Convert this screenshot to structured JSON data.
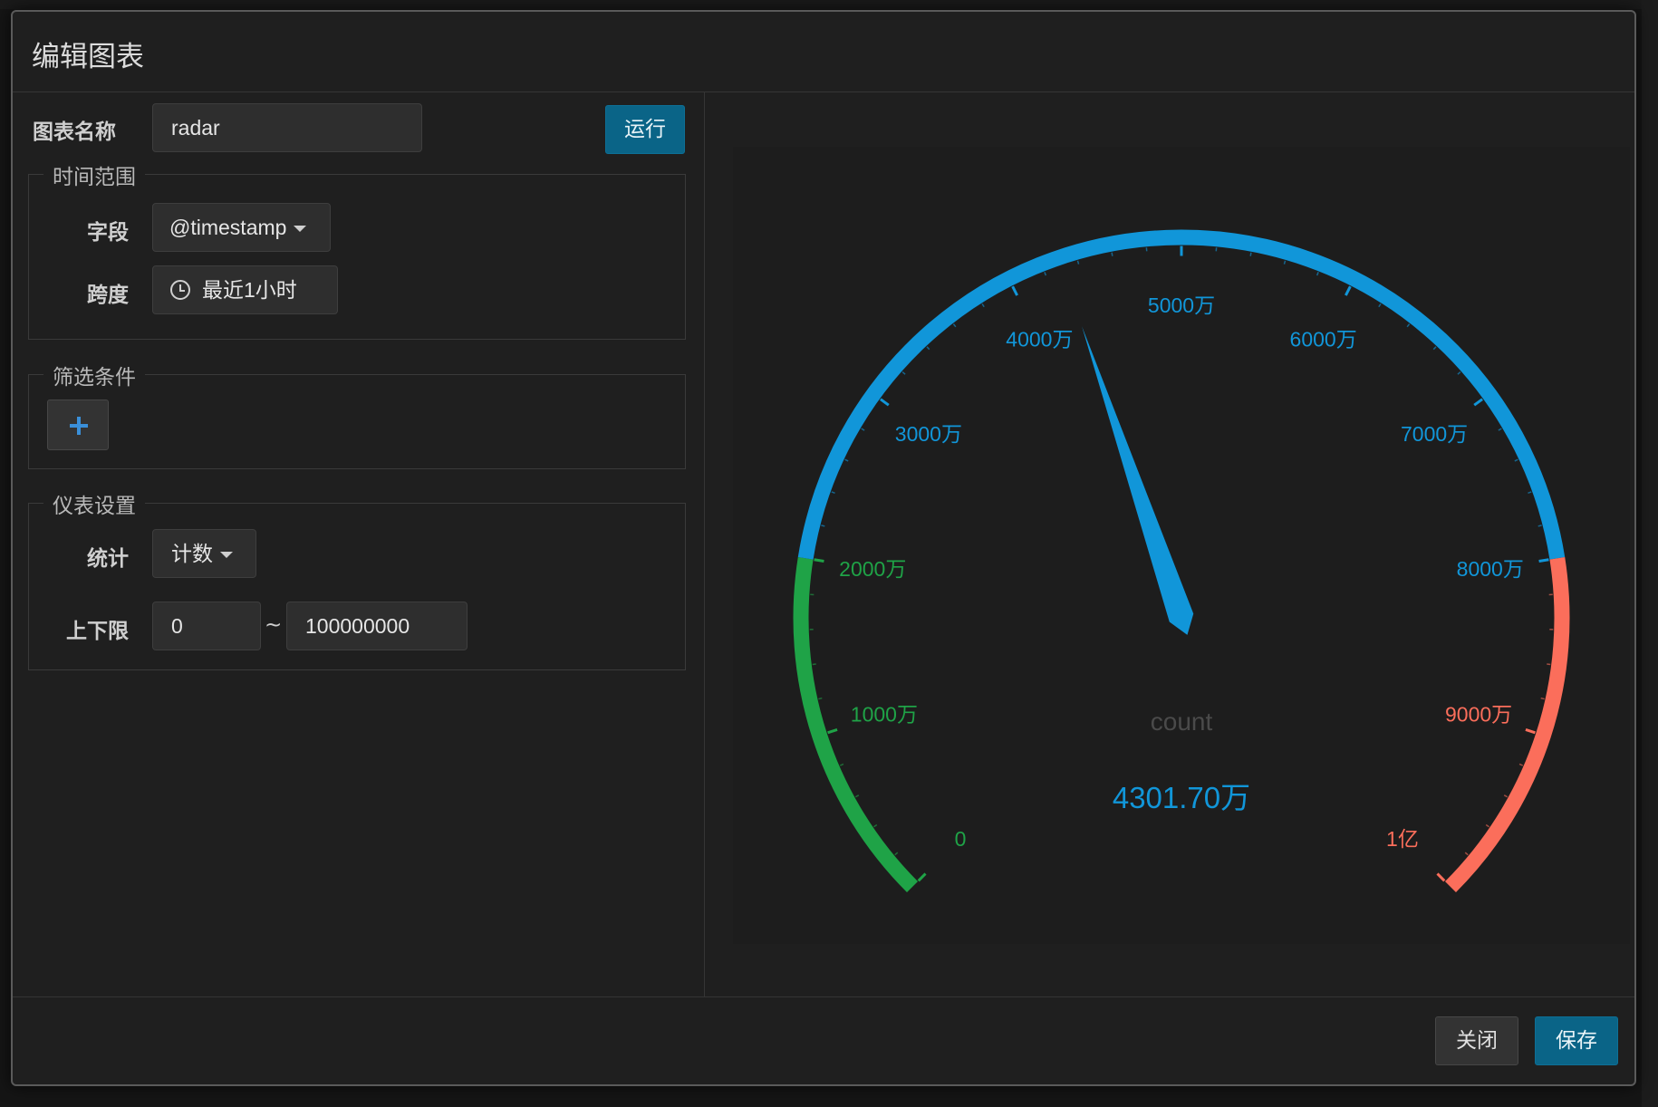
{
  "modal": {
    "title": "编辑图表"
  },
  "form": {
    "chart_name_label": "图表名称",
    "chart_name_value": "radar",
    "run_button": "运行",
    "time_range": {
      "legend": "时间范围",
      "field_label": "字段",
      "field_value": "@timestamp",
      "span_label": "跨度",
      "span_value": "最近1小时"
    },
    "filter": {
      "legend": "筛选条件"
    },
    "gauge_settings": {
      "legend": "仪表设置",
      "stat_label": "统计",
      "stat_value": "计数",
      "bounds_label": "上下限",
      "lower_value": "0",
      "separator": "~",
      "upper_value": "100000000"
    }
  },
  "footer": {
    "close_button": "关闭",
    "save_button": "保存"
  },
  "colors": {
    "accent": "#0a6487",
    "gauge_blue": "#1196d9",
    "gauge_green": "#1fa347",
    "gauge_red": "#fb6e5b"
  },
  "chart_data": {
    "type": "gauge",
    "min": 0,
    "max": 100000000,
    "value": 43017000,
    "value_label": "4301.70万",
    "series_name": "count",
    "tick_labels": [
      "0",
      "1000万",
      "2000万",
      "3000万",
      "4000万",
      "5000万",
      "6000万",
      "7000万",
      "8000万",
      "9000万",
      "1亿"
    ],
    "bands": [
      {
        "from": 0,
        "to": 20000000,
        "color": "#1fa347"
      },
      {
        "from": 20000000,
        "to": 80000000,
        "color": "#1196d9"
      },
      {
        "from": 80000000,
        "to": 100000000,
        "color": "#fb6e5b"
      }
    ]
  }
}
